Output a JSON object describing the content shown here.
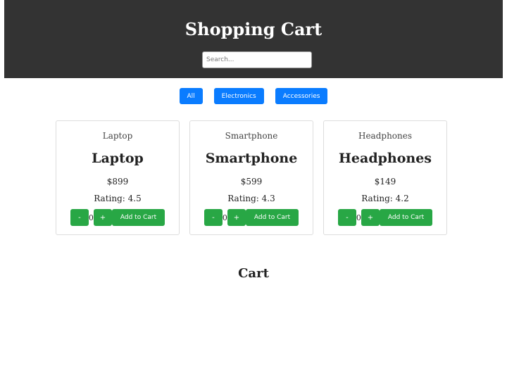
{
  "header": {
    "title": "Shopping Cart",
    "search_placeholder": "Search..."
  },
  "filters": [
    "All",
    "Electronics",
    "Accessories"
  ],
  "products": [
    {
      "image_alt": "Laptop",
      "name": "Laptop",
      "price": "$899",
      "rating": "Rating: 4.5",
      "quantity": "0",
      "minus": "-",
      "plus": "+",
      "add_label": "Add to Cart"
    },
    {
      "image_alt": "Smartphone",
      "name": "Smartphone",
      "price": "$599",
      "rating": "Rating: 4.3",
      "quantity": "0",
      "minus": "-",
      "plus": "+",
      "add_label": "Add to Cart"
    },
    {
      "image_alt": "Headphones",
      "name": "Headphones",
      "price": "$149",
      "rating": "Rating: 4.2",
      "quantity": "0",
      "minus": "-",
      "plus": "+",
      "add_label": "Add to Cart"
    }
  ],
  "cart": {
    "title": "Cart"
  },
  "colors": {
    "header_bg": "#333333",
    "filter_button": "#0a7cff",
    "action_button": "#28a745"
  }
}
